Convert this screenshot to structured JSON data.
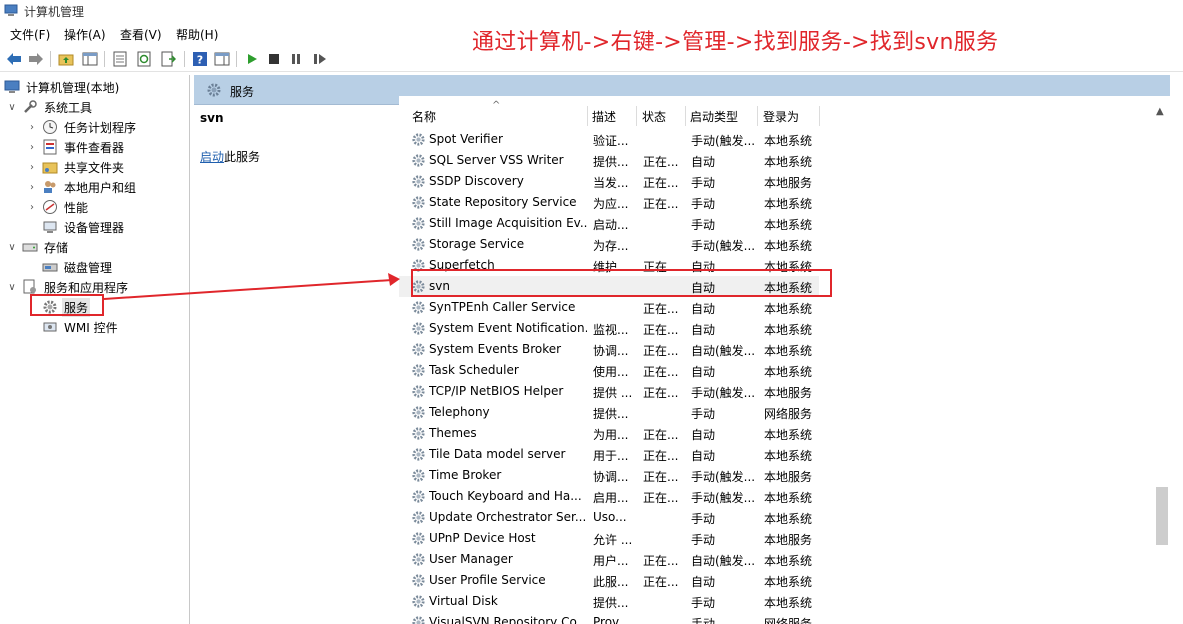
{
  "window": {
    "title": "计算机管理"
  },
  "menu": [
    "文件(F)",
    "操作(A)",
    "查看(V)",
    "帮助(H)"
  ],
  "annotation": "通过计算机->右键->管理->找到服务->找到svn服务",
  "tree": {
    "root": "计算机管理(本地)",
    "system_tools": "系统工具",
    "task_scheduler": "任务计划程序",
    "event_viewer": "事件查看器",
    "shared_folders": "共享文件夹",
    "local_users": "本地用户和组",
    "performance": "性能",
    "device_manager": "设备管理器",
    "storage": "存储",
    "disk_management": "磁盘管理",
    "services_apps": "服务和应用程序",
    "services": "服务",
    "wmi": "WMI 控件"
  },
  "pane": {
    "title": "服务"
  },
  "detail": {
    "service_name": "svn",
    "start_link": "启动",
    "start_suffix": "此服务"
  },
  "columns": {
    "name": "名称",
    "desc": "描述",
    "status": "状态",
    "startup": "启动类型",
    "logon": "登录为"
  },
  "services": [
    {
      "name": "Spot Verifier",
      "desc": "验证...",
      "status": "",
      "startup": "手动(触发...",
      "logon": "本地系统"
    },
    {
      "name": "SQL Server VSS Writer",
      "desc": "提供...",
      "status": "正在...",
      "startup": "自动",
      "logon": "本地系统"
    },
    {
      "name": "SSDP Discovery",
      "desc": "当发...",
      "status": "正在...",
      "startup": "手动",
      "logon": "本地服务"
    },
    {
      "name": "State Repository Service",
      "desc": "为应...",
      "status": "正在...",
      "startup": "手动",
      "logon": "本地系统"
    },
    {
      "name": "Still Image Acquisition Ev...",
      "desc": "启动...",
      "status": "",
      "startup": "手动",
      "logon": "本地系统"
    },
    {
      "name": "Storage Service",
      "desc": "为存...",
      "status": "",
      "startup": "手动(触发...",
      "logon": "本地系统"
    },
    {
      "name": "Superfetch",
      "desc": "维护...",
      "status": "正在...",
      "startup": "自动",
      "logon": "本地系统"
    },
    {
      "name": "svn",
      "desc": "",
      "status": "",
      "startup": "自动",
      "logon": "本地系统"
    },
    {
      "name": "SynTPEnh Caller Service",
      "desc": "",
      "status": "正在...",
      "startup": "自动",
      "logon": "本地系统"
    },
    {
      "name": "System Event Notification...",
      "desc": "监视...",
      "status": "正在...",
      "startup": "自动",
      "logon": "本地系统"
    },
    {
      "name": "System Events Broker",
      "desc": "协调...",
      "status": "正在...",
      "startup": "自动(触发...",
      "logon": "本地系统"
    },
    {
      "name": "Task Scheduler",
      "desc": "使用...",
      "status": "正在...",
      "startup": "自动",
      "logon": "本地系统"
    },
    {
      "name": "TCP/IP NetBIOS Helper",
      "desc": "提供 ...",
      "status": "正在...",
      "startup": "手动(触发...",
      "logon": "本地服务"
    },
    {
      "name": "Telephony",
      "desc": "提供...",
      "status": "",
      "startup": "手动",
      "logon": "网络服务"
    },
    {
      "name": "Themes",
      "desc": "为用...",
      "status": "正在...",
      "startup": "自动",
      "logon": "本地系统"
    },
    {
      "name": "Tile Data model server",
      "desc": "用于...",
      "status": "正在...",
      "startup": "自动",
      "logon": "本地系统"
    },
    {
      "name": "Time Broker",
      "desc": "协调...",
      "status": "正在...",
      "startup": "手动(触发...",
      "logon": "本地服务"
    },
    {
      "name": "Touch Keyboard and Ha...",
      "desc": "启用...",
      "status": "正在...",
      "startup": "手动(触发...",
      "logon": "本地系统"
    },
    {
      "name": "Update Orchestrator Ser...",
      "desc": "Uso...",
      "status": "",
      "startup": "手动",
      "logon": "本地系统"
    },
    {
      "name": "UPnP Device Host",
      "desc": "允许 ...",
      "status": "",
      "startup": "手动",
      "logon": "本地服务"
    },
    {
      "name": "User Manager",
      "desc": "用户...",
      "status": "正在...",
      "startup": "自动(触发...",
      "logon": "本地系统"
    },
    {
      "name": "User Profile Service",
      "desc": "此服...",
      "status": "正在...",
      "startup": "自动",
      "logon": "本地系统"
    },
    {
      "name": "Virtual Disk",
      "desc": "提供...",
      "status": "",
      "startup": "手动",
      "logon": "本地系统"
    },
    {
      "name": "VisualSVN Repository Co...",
      "desc": "Prov...",
      "status": "",
      "startup": "手动",
      "logon": "网络服务"
    }
  ],
  "colors": {
    "annotation": "#e0262b",
    "header_blue": "#b8cfe5",
    "link": "#1f5fae"
  }
}
